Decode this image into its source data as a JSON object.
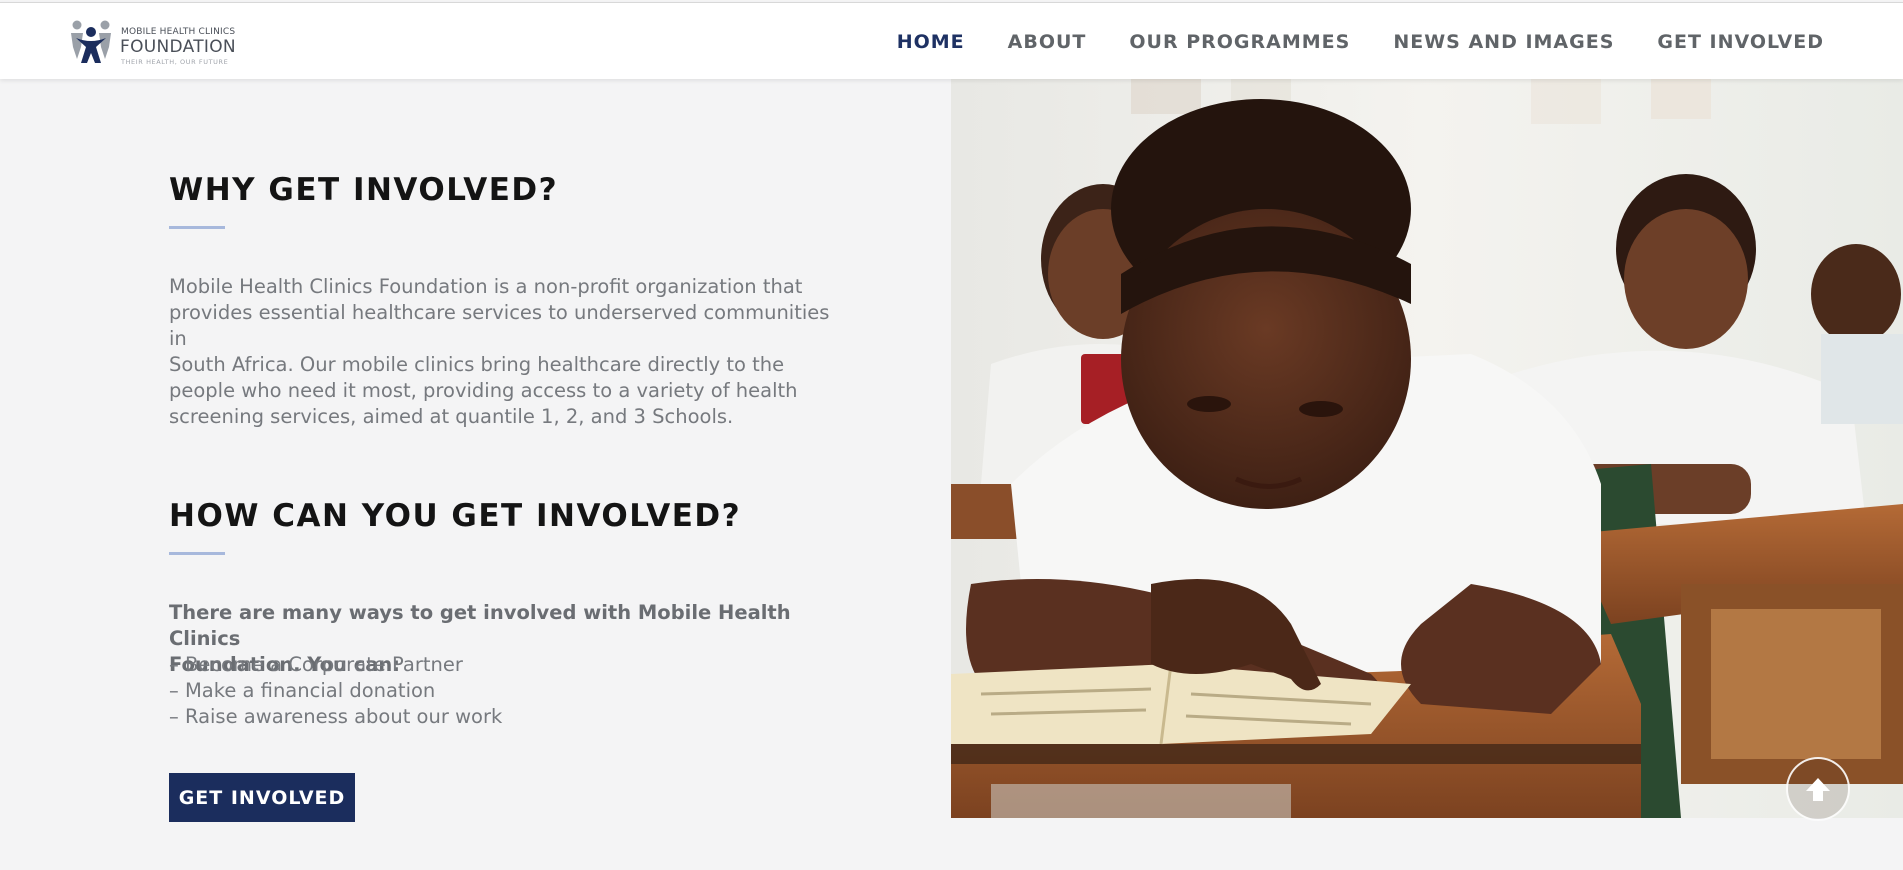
{
  "header": {
    "logo": {
      "line1": "MOBILE HEALTH CLINICS",
      "line2": "FOUNDATION",
      "tagline": "THEIR HEALTH, OUR FUTURE"
    },
    "nav": [
      {
        "label": "HOME",
        "active": true
      },
      {
        "label": "ABOUT",
        "active": false
      },
      {
        "label": "OUR PROGRAMMES",
        "active": false
      },
      {
        "label": "NEWS AND IMAGES",
        "active": false
      },
      {
        "label": "GET INVOLVED",
        "active": false
      }
    ]
  },
  "why": {
    "heading": "WHY GET INVOLVED?",
    "body_lines": [
      "Mobile Health Clinics Foundation is a non-profit organization that",
      "provides essential healthcare services to underserved communities in",
      "South Africa. Our mobile clinics bring healthcare directly to the",
      "people who need it most, providing access to a variety of health",
      "screening services, aimed at quantile 1, 2, and 3 Schools."
    ]
  },
  "how": {
    "heading": "HOW CAN YOU GET INVOLVED?",
    "intro_lines": [
      "There are many ways to get involved with Mobile Health Clinics",
      "Foundation. You can:"
    ],
    "items": [
      "– Become a Corporate Partner",
      "– Make a financial donation",
      "– Raise awareness about our work"
    ],
    "button_label": "GET INVOLVED"
  },
  "colors": {
    "brand_navy": "#1b2d5d",
    "accent_underline": "#a7b8dc",
    "nav_active": "#1e3163",
    "background": "#f4f4f5"
  },
  "icons": {
    "scroll_top": "arrow-up-icon"
  }
}
